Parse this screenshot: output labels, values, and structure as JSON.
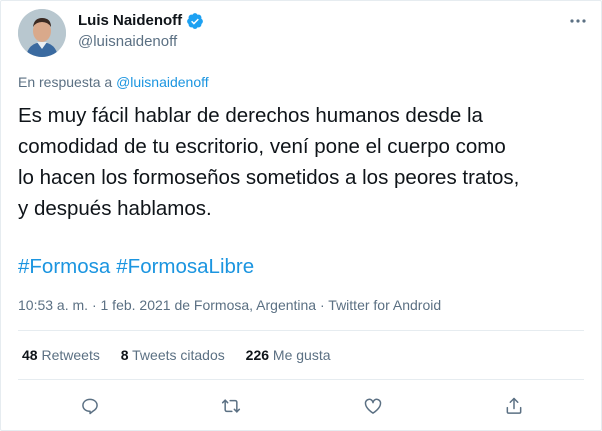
{
  "author": {
    "name": "Luis Naidenoff",
    "handle": "@luisnaidenoff",
    "verified": true
  },
  "reply": {
    "prefix": "En respuesta a",
    "mention": "@luisnaidenoff"
  },
  "tweet": {
    "text": "Es muy fácil hablar de derechos humanos desde la\ncomodidad de tu escritorio, vení pone el cuerpo como\nlo hacen los formoseños sometidos a los peores tratos,\ny después hablamos.",
    "hashtags": [
      "#Formosa",
      "#FormosaLibre"
    ]
  },
  "meta": {
    "time": "10:53 a. m.",
    "date": "1 feb. 2021",
    "location": "de Formosa, Argentina",
    "source": "Twitter for Android"
  },
  "stats": {
    "retweets_count": "48",
    "retweets_label": "Retweets",
    "quotes_count": "8",
    "quotes_label": "Tweets citados",
    "likes_count": "226",
    "likes_label": "Me gusta"
  },
  "actions": [
    "reply-icon",
    "retweet-icon",
    "like-icon",
    "share-icon"
  ],
  "colors": {
    "accent": "#1b95e0",
    "secondary_text": "#5b7083",
    "primary_text": "#0f1419",
    "divider": "#e6ecf0",
    "verified": "#1da1f2"
  }
}
